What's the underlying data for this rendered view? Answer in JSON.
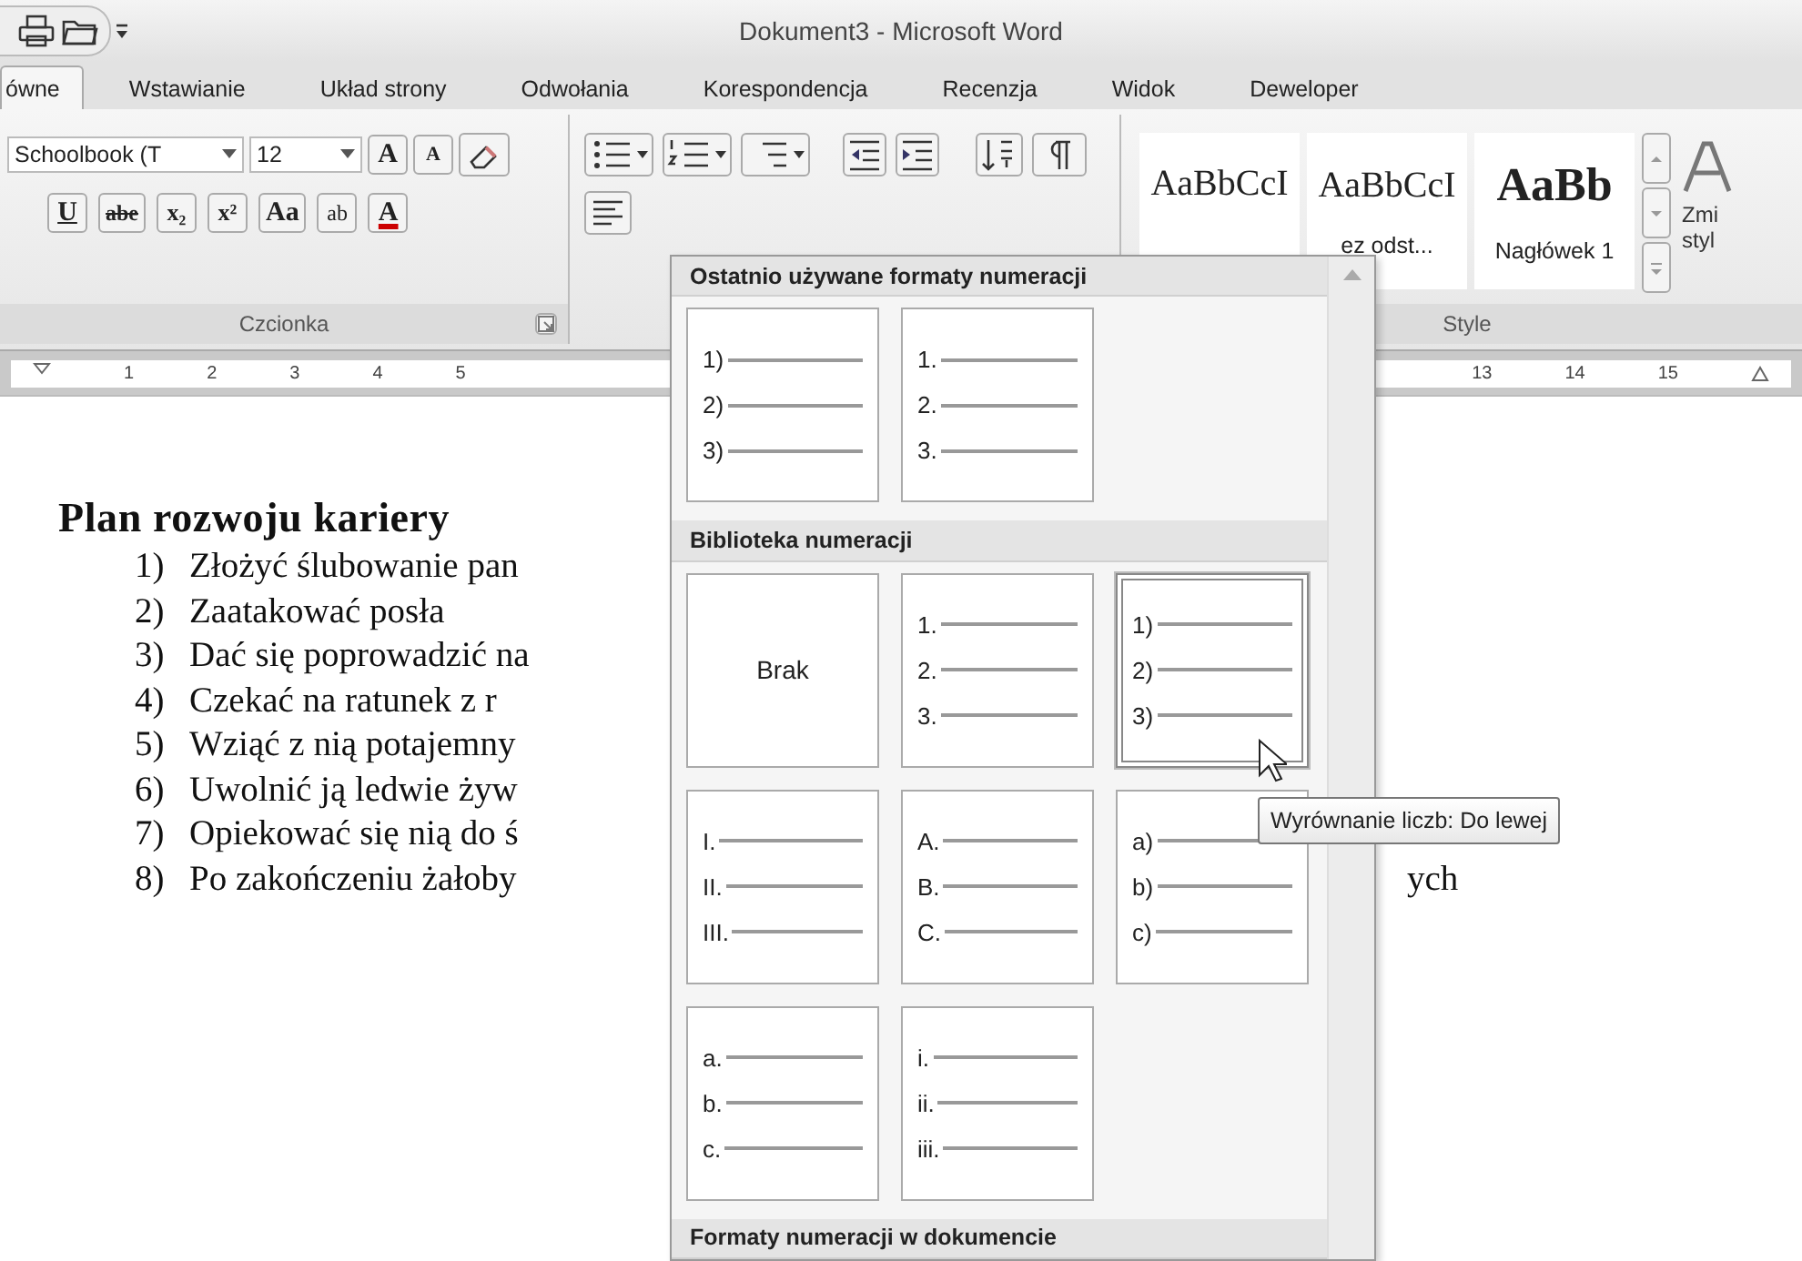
{
  "window": {
    "title": "Dokument3 - Microsoft Word"
  },
  "tabs": [
    {
      "label": "ówne",
      "selected": true
    },
    {
      "label": "Wstawianie",
      "selected": false
    },
    {
      "label": "Układ strony",
      "selected": false
    },
    {
      "label": "Odwołania",
      "selected": false
    },
    {
      "label": "Korespondencja",
      "selected": false
    },
    {
      "label": "Recenzja",
      "selected": false
    },
    {
      "label": "Widok",
      "selected": false
    },
    {
      "label": "Deweloper",
      "selected": false
    }
  ],
  "ribbon": {
    "font": {
      "font_name": "Schoolbook (T",
      "font_size": "12",
      "row1": [
        {
          "kind": "grow",
          "label": "A"
        },
        {
          "kind": "shrink",
          "label": "A"
        }
      ],
      "row2": [
        {
          "kind": "underline",
          "label": "U"
        },
        {
          "kind": "strike",
          "label": "abe"
        },
        {
          "kind": "subscript",
          "label": "x₂"
        },
        {
          "kind": "superscript",
          "label": "x²"
        },
        {
          "kind": "case",
          "label": "Aa"
        },
        {
          "kind": "highlight",
          "label": "ab"
        },
        {
          "kind": "color",
          "label": "A"
        }
      ],
      "group_label": "Czcionka"
    },
    "styles": {
      "gallery": [
        {
          "sample": "AaBbCcI",
          "kind": "normal"
        },
        {
          "sample": "AaBbCcI",
          "name": "ez odst...",
          "kind": "normal"
        },
        {
          "sample": "AaBb",
          "name": "Nagłówek 1",
          "kind": "heading"
        }
      ],
      "change_styles": [
        "Zmi",
        "styl"
      ],
      "group_label": "Style"
    }
  },
  "ruler": {
    "left_numbers": [
      "1",
      "2",
      "3",
      "4",
      "5"
    ],
    "right_numbers": [
      "13",
      "14",
      "15"
    ]
  },
  "document": {
    "heading": "Plan rozwoju kariery",
    "items": [
      {
        "number": "1)",
        "text": "Złożyć ślubowanie pan"
      },
      {
        "number": "2)",
        "text": "Zaatakować posła"
      },
      {
        "number": "3)",
        "text": "Dać się poprowadzić na"
      },
      {
        "number": "4)",
        "text": "Czekać na ratunek  z r"
      },
      {
        "number": "5)",
        "text": "Wziąć z nią potajemny"
      },
      {
        "number": "6)",
        "text": "Uwolnić ją ledwie żyw"
      },
      {
        "number": "7)",
        "text": "Opiekować się nią do ś"
      },
      {
        "number": "8)",
        "text": "Po zakończeniu żałoby",
        "tail": "ych"
      }
    ]
  },
  "numbering_menu": {
    "sections": [
      {
        "title": "Ostatnio używane formaty numeracji",
        "tiles": [
          {
            "kind": "list",
            "markers": [
              "1)",
              "2)",
              "3)"
            ],
            "selected": false
          },
          {
            "kind": "list",
            "markers": [
              "1.",
              "2.",
              "3."
            ],
            "selected": false
          }
        ]
      },
      {
        "title": "Biblioteka numeracji",
        "tiles": [
          {
            "kind": "none",
            "label": "Brak",
            "selected": false
          },
          {
            "kind": "list",
            "markers": [
              "1.",
              "2.",
              "3."
            ],
            "selected": false
          },
          {
            "kind": "list",
            "markers": [
              "1)",
              "2)",
              "3)"
            ],
            "selected": true
          },
          {
            "kind": "list",
            "markers": [
              "I.",
              "II.",
              "III."
            ],
            "selected": false
          },
          {
            "kind": "list",
            "markers": [
              "A.",
              "B.",
              "C."
            ],
            "selected": false
          },
          {
            "kind": "list",
            "markers": [
              "a)",
              "b)",
              "c)"
            ],
            "selected": false
          },
          {
            "kind": "list",
            "markers": [
              "a.",
              "b.",
              "c."
            ],
            "selected": false
          },
          {
            "kind": "list",
            "markers": [
              "i.",
              "ii.",
              "iii."
            ],
            "selected": false
          }
        ]
      },
      {
        "title": "Formaty numeracji w dokumencie"
      }
    ]
  },
  "tooltip": "Wyrównanie liczb: Do lewej"
}
